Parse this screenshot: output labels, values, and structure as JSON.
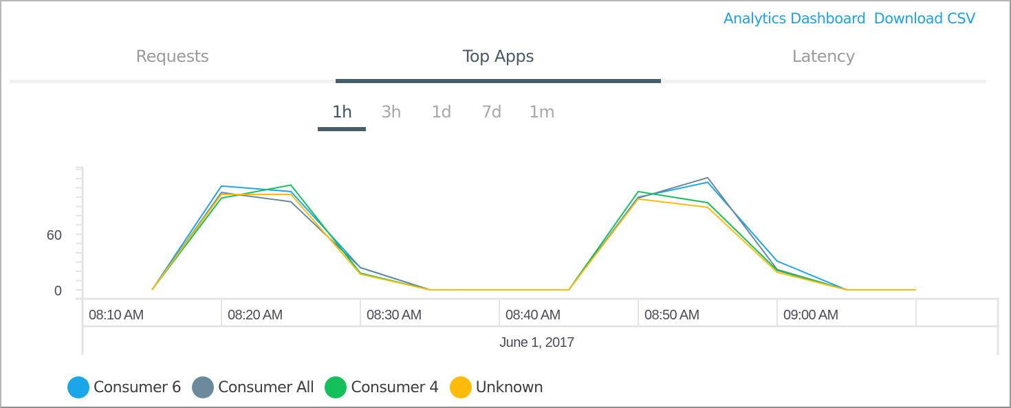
{
  "header": {
    "links": [
      "Analytics Dashboard",
      "Download CSV"
    ]
  },
  "tabs": [
    {
      "label": "Requests",
      "active": false
    },
    {
      "label": "Top Apps",
      "active": true
    },
    {
      "label": "Latency",
      "active": false
    }
  ],
  "time_ranges": [
    {
      "label": "1h",
      "active": true
    },
    {
      "label": "3h",
      "active": false
    },
    {
      "label": "1d",
      "active": false
    },
    {
      "label": "7d",
      "active": false
    },
    {
      "label": "1m",
      "active": false
    }
  ],
  "chart_data": {
    "type": "line",
    "title": "",
    "xlabel": "June 1, 2017",
    "ylabel": "",
    "ylim": [
      0,
      130
    ],
    "y_ticks_labeled": [
      0,
      60
    ],
    "y_tick_step": 10,
    "x_tick_labels": [
      "08:10 AM",
      "08:20 AM",
      "08:30 AM",
      "08:40 AM",
      "08:50 AM",
      "09:00 AM"
    ],
    "x": [
      "08:15",
      "08:20",
      "08:25",
      "08:30",
      "08:35",
      "08:40",
      "08:45",
      "08:50",
      "08:55",
      "09:00",
      "09:05",
      "09:10"
    ],
    "x_minutes_after_0810": [
      5,
      10,
      15,
      20,
      25,
      30,
      35,
      40,
      45,
      50,
      55,
      60
    ],
    "x_range_minutes_after_0810": [
      0,
      65
    ],
    "grid": false,
    "legend_position": "bottom-left",
    "series": [
      {
        "name": "Consumer 6",
        "color": "#1aa6e8",
        "values": [
          0,
          112,
          106,
          24,
          0,
          0,
          0,
          100,
          116,
          31,
          0,
          0
        ]
      },
      {
        "name": "Consumer All",
        "color": "#6a8a9b",
        "values": [
          0,
          105,
          95,
          24,
          0,
          0,
          0,
          99,
          121,
          22,
          0,
          0
        ]
      },
      {
        "name": "Consumer 4",
        "color": "#12c15a",
        "values": [
          0,
          99,
          113,
          18,
          0,
          0,
          0,
          106,
          94,
          21,
          0,
          0
        ]
      },
      {
        "name": "Unknown",
        "color": "#ffbb0a",
        "values": [
          0,
          103,
          103,
          17,
          0,
          0,
          0,
          98,
          89,
          19,
          0,
          0
        ]
      }
    ]
  }
}
